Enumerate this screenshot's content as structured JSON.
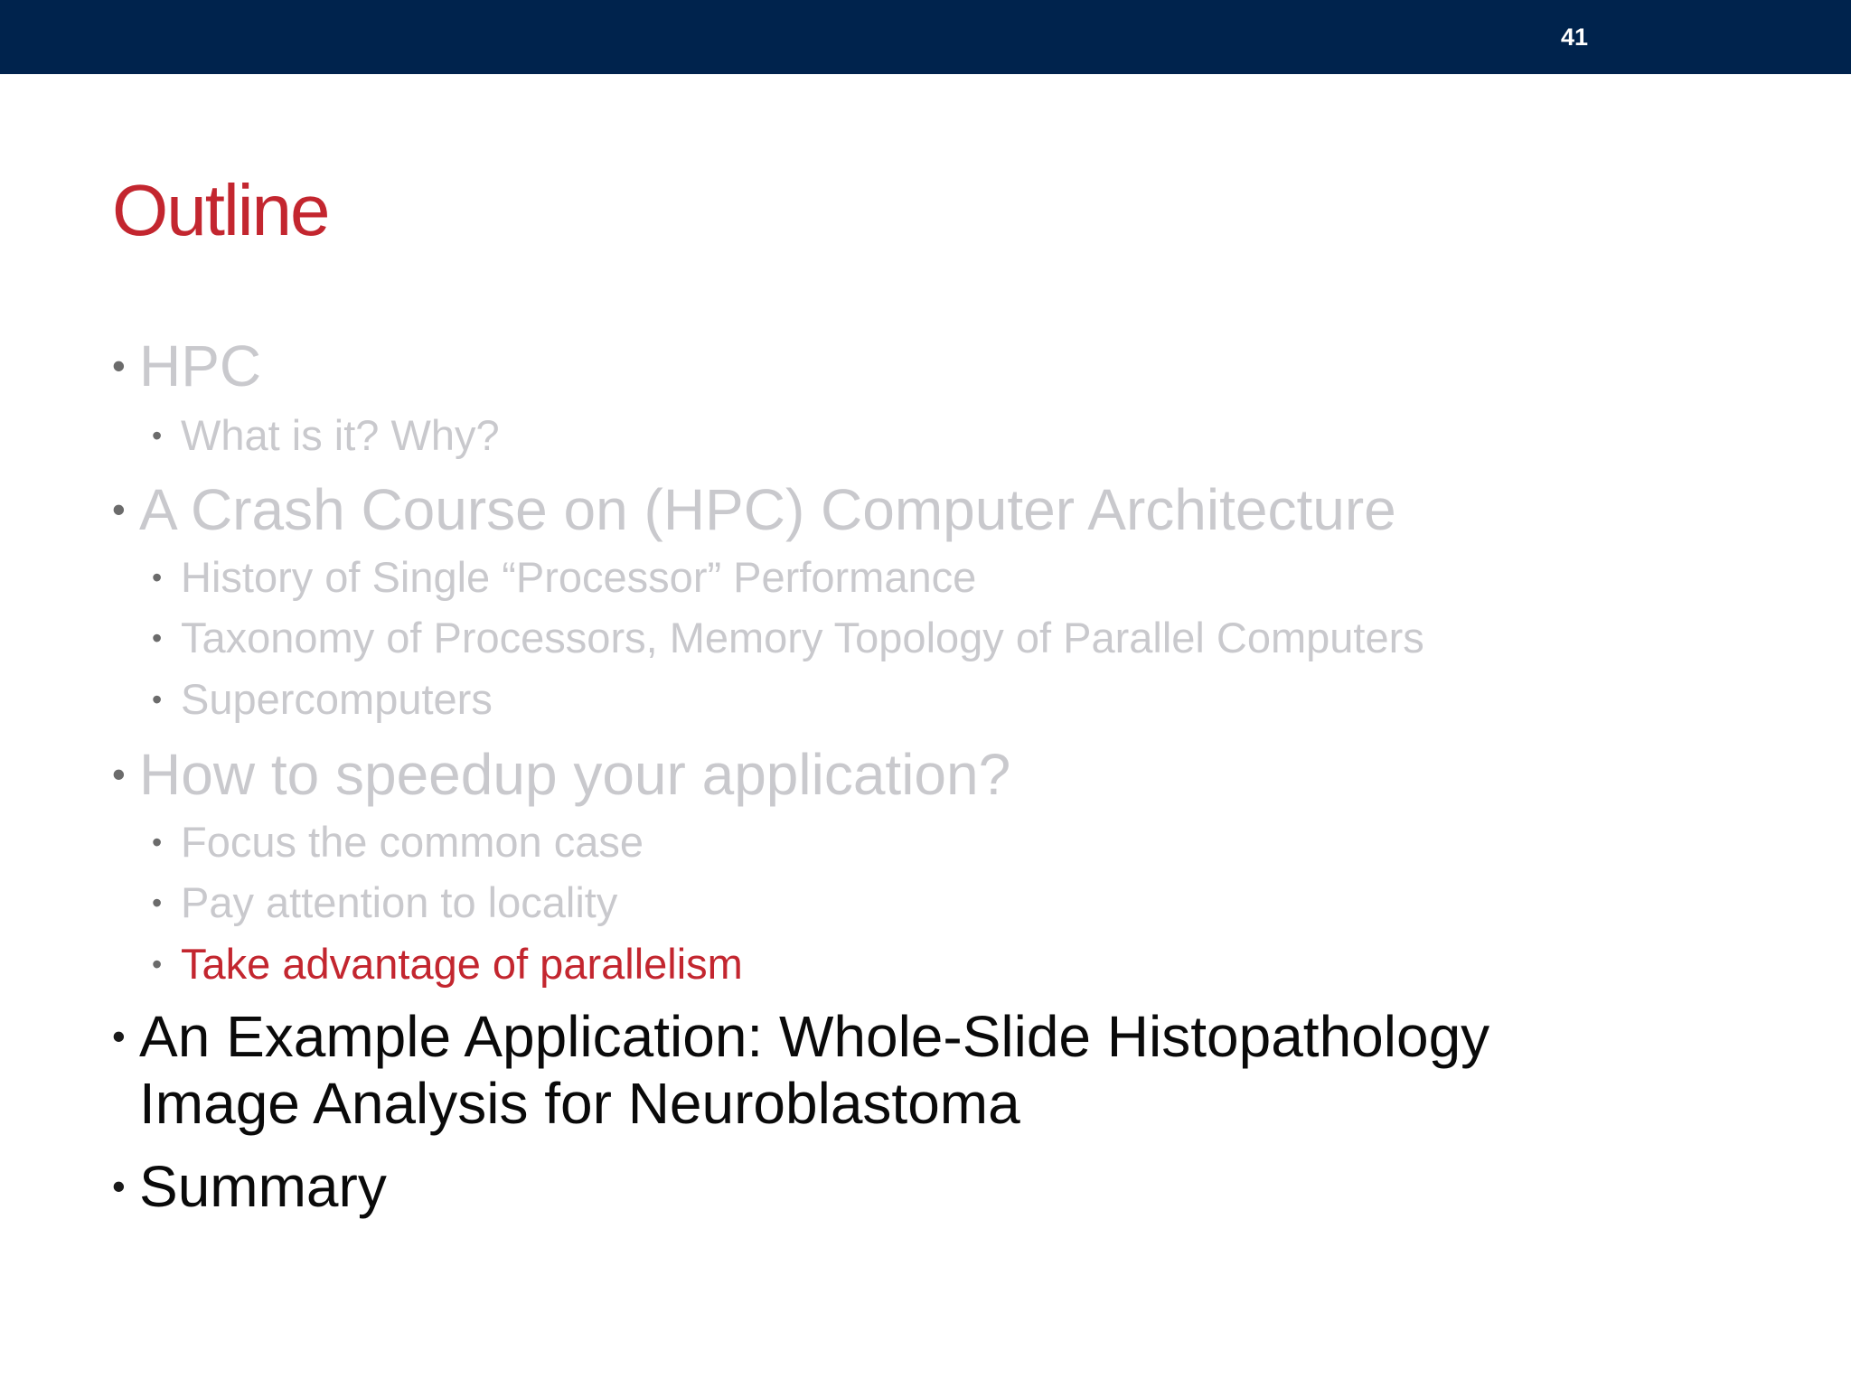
{
  "slide": {
    "page_number": "41",
    "title": "Outline",
    "colors": {
      "top_bar": "#00234d",
      "title": "#c3262f",
      "highlight": "#c3262f",
      "faded_text": "#c9c9cd",
      "current_text": "#0a0a0a"
    },
    "outline": [
      {
        "level": 1,
        "state": "faded",
        "text": "HPC"
      },
      {
        "level": 2,
        "state": "faded",
        "text": "What is it? Why?"
      },
      {
        "level": 1,
        "state": "faded",
        "text": "A Crash Course on (HPC) Computer Architecture"
      },
      {
        "level": 2,
        "state": "faded",
        "text": "History of Single “Processor” Performance"
      },
      {
        "level": 2,
        "state": "faded",
        "text": "Taxonomy of Processors, Memory Topology of Parallel Computers"
      },
      {
        "level": 2,
        "state": "faded",
        "text": "Supercomputers"
      },
      {
        "level": 1,
        "state": "faded",
        "text": "How to speedup your application?"
      },
      {
        "level": 2,
        "state": "faded",
        "text": "Focus the common case"
      },
      {
        "level": 2,
        "state": "faded",
        "text": "Pay attention to locality"
      },
      {
        "level": 2,
        "state": "highlighted",
        "text": "Take advantage of parallelism"
      },
      {
        "level": 1,
        "state": "normal",
        "text": "An Example Application: Whole-Slide Histopathology Image Analysis for Neuroblastoma"
      },
      {
        "level": 1,
        "state": "normal",
        "text": "Summary"
      }
    ]
  }
}
